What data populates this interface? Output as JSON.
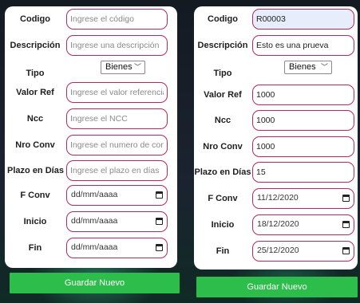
{
  "labels": {
    "codigo": "Codigo",
    "descripcion": "Descripción",
    "tipo": "Tipo",
    "valor_ref": "Valor Ref",
    "ncc": "Ncc",
    "nro_conv": "Nro Conv",
    "plazo": "Plazo en Días",
    "f_conv": "F Conv",
    "inicio": "Inicio",
    "fin": "Fin"
  },
  "empty_form": {
    "placeholders": {
      "codigo": "Ingrese el código",
      "descripcion": "Ingrese una descripción",
      "valor_ref": "Ingrese el valor referencia",
      "ncc": "Ingrese el NCC",
      "nro_conv": "Ingrese el numero de convenio",
      "plazo": "Ingrese el plazo en días"
    },
    "tipo": "Bienes",
    "date_placeholder": "dd/mm/aaaa",
    "submit_label": "Guardar Nuevo"
  },
  "filled_form": {
    "codigo": "R00003",
    "descripcion": "Esto es una prueva",
    "tipo": "Bienes",
    "valor_ref": "1000",
    "ncc": "1000",
    "nro_conv": "1000",
    "plazo": "15",
    "f_conv": "11/12/2020",
    "inicio": "18/12/2020",
    "fin": "25/12/2020",
    "submit_label": "Guardar Nuevo"
  },
  "icons": {
    "date": "calendar-icon",
    "select": "chevron-down-icon"
  },
  "colors": {
    "field_border": "#b12a5b",
    "button": "#2dbd4a",
    "readonly_fill": "#e8edfb"
  }
}
